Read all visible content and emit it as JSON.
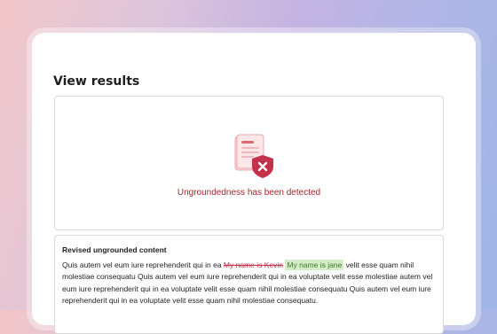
{
  "page": {
    "title": "View results"
  },
  "result": {
    "icon": "document-shield-error-icon",
    "message": "Ungroundedness has been detected",
    "accent_color": "#a4262c"
  },
  "revised": {
    "heading": "Revised ungrounded content",
    "text_before": "Quis autem vel eum iure reprehenderit qui in ea ",
    "removed": "My name is Kevin",
    "added": "My name is jane",
    "text_after": " velit esse quam nihil molestiae consequatu Quis autem vel eum iure reprehenderit qui in ea voluptate velit esse molestiae  autem vel eum iure reprehenderit qui in ea voluptate velit esse quam nihil molestiae consequatu Quis autem vel eum iure reprehenderit qui in ea voluptate velit esse quam nihil molestiae consequatu.",
    "removed_color": "#c4314b",
    "added_color": "#d4ecc7"
  }
}
